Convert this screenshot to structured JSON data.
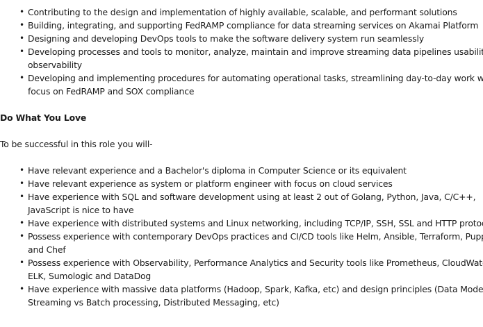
{
  "responsibilities": [
    "Contributing to the design and implementation of highly available, scalable, and performant solutions",
    "Building, integrating, and supporting FedRAMP compliance for data streaming services on Akamai Platform",
    "Designing and developing DevOps tools to make the software delivery system run seamlessly",
    "Developing processes and tools to monitor, analyze, maintain and improve streaming data pipelines usability and observability",
    "Developing and implementing procedures for automating operational tasks, streamlining day-to-day work with focus on FedRAMP and SOX compliance"
  ],
  "section_heading": "Do What You Love",
  "intro_text": "To be successful in this role you will-",
  "requirements": [
    "Have relevant experience and a Bachelor's diploma in Computer Science or its equivalent",
    "Have relevant experience as system or platform engineer with focus on cloud services",
    "Have experience with SQL and software development using at least 2 out of Golang, Python, Java, C/C++, JavaScript is nice to have",
    "Have experience with distributed systems and Linux networking, including TCP/IP, SSH, SSL and HTTP protocols",
    "Possess experience with contemporary DevOps practices and CI/CD tools like Helm, Ansible, Terraform, Puppet, and Chef",
    "Possess experience with Observability, Performance Analytics and Security tools like Prometheus, CloudWatch, ELK, Sumologic and DataDog",
    "Have experience with massive data platforms (Hadoop, Spark, Kafka, etc) and design principles (Data Modeling, Streaming vs Batch processing, Distributed Messaging, etc)"
  ]
}
